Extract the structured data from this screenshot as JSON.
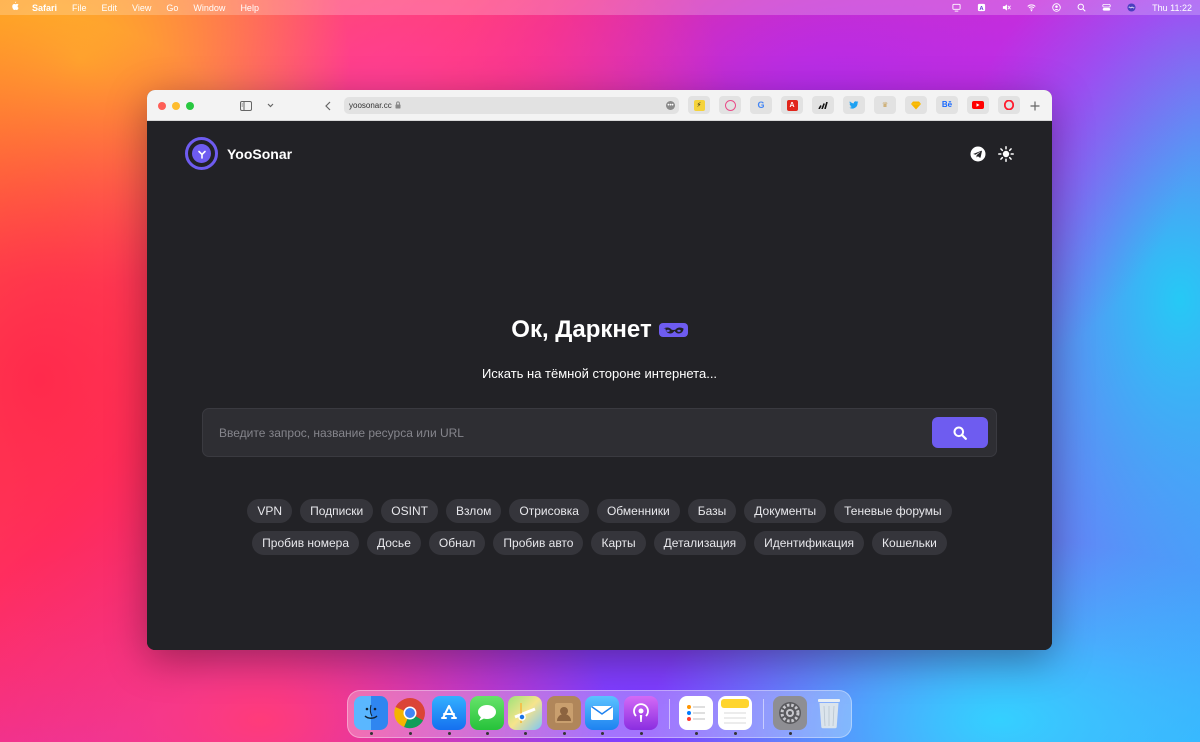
{
  "menubar": {
    "app_name": "Safari",
    "items": [
      "File",
      "Edit",
      "View",
      "Go",
      "Window",
      "Help"
    ],
    "clock": "Thu 11:22"
  },
  "browser": {
    "url": "yoosonar.cc",
    "favorites": [
      {
        "name": "favorite-1",
        "glyph": "⚡",
        "color": "#f5b400"
      },
      {
        "name": "dribbble",
        "glyph": "◎",
        "color": "#ea4c89"
      },
      {
        "name": "google",
        "glyph": "G",
        "color": "#4285f4"
      },
      {
        "name": "adobe",
        "glyph": "A",
        "color": "#e1251b"
      },
      {
        "name": "adidas",
        "glyph": "▲",
        "color": "#111111"
      },
      {
        "name": "twitter",
        "glyph": "🐦",
        "color": "#1da1f2"
      },
      {
        "name": "favorite-7",
        "glyph": "♛",
        "color": "#c8a25a"
      },
      {
        "name": "sketch",
        "glyph": "◆",
        "color": "#f7b500"
      },
      {
        "name": "behance",
        "glyph": "Bē",
        "color": "#1769ff"
      },
      {
        "name": "youtube",
        "glyph": "▶",
        "color": "#ff0000"
      },
      {
        "name": "opera",
        "glyph": "O",
        "color": "#ff1b2d"
      }
    ]
  },
  "site": {
    "brand": "YooSonar",
    "headline": "Ок, Даркнет",
    "subheadline": "Искать на тёмной стороне интернета...",
    "search_placeholder": "Введите запрос, название ресурса или URL",
    "accent": "#6e5cf0",
    "tags_row1": [
      "VPN",
      "Подписки",
      "OSINT",
      "Взлом",
      "Отрисовка",
      "Обменники",
      "Базы",
      "Документы",
      "Теневые форумы"
    ],
    "tags_row2": [
      "Пробив номера",
      "Досье",
      "Обнал",
      "Пробив авто",
      "Карты",
      "Детализация",
      "Идентификация",
      "Кошельки"
    ]
  },
  "dock": {
    "apps": [
      "finder",
      "chrome",
      "app-store",
      "messages",
      "maps",
      "contacts",
      "mail",
      "podcasts",
      "reminders",
      "notes",
      "system-settings",
      "trash"
    ]
  }
}
